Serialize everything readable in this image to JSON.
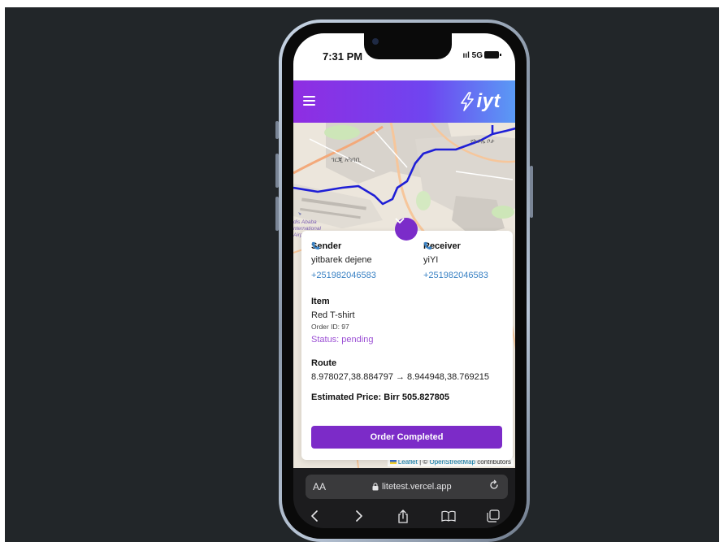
{
  "statusbar": {
    "time": "7:31 PM",
    "network": "5G"
  },
  "appbar": {
    "logo_text": "iyt"
  },
  "map": {
    "labels": [
      "ገርጂ አካባቢ",
      "የካ ቦሌ ቦታ",
      "dis Ababa",
      "nternational",
      "Airp"
    ],
    "attribution": {
      "leaflet": "Leaflet",
      "separator": " | © ",
      "osm": "OpenStreetMap",
      "suffix": " contributors"
    }
  },
  "order": {
    "sender_label": "Sender",
    "sender_name": "yitbarek dejene",
    "sender_phone": "+251982046583",
    "receiver_label": "Receiver",
    "receiver_name": "yiYI",
    "receiver_phone": "+251982046583",
    "item_label": "Item",
    "item_name": "Red T-shirt",
    "order_id": "Order ID: 97",
    "status": "Status: pending",
    "route_label": "Route",
    "route_value": "8.978027,38.884797 → 8.944948,38.769215",
    "price": "Estimated Price: Birr 505.827805",
    "complete_button": "Order Completed"
  },
  "browser": {
    "aa": "AA",
    "url": "litetest.vercel.app"
  },
  "colors": {
    "accent": "#7c2bc8",
    "link": "#3a82c4",
    "status": "#9b4fd4",
    "route_line": "#1f1fd6"
  }
}
